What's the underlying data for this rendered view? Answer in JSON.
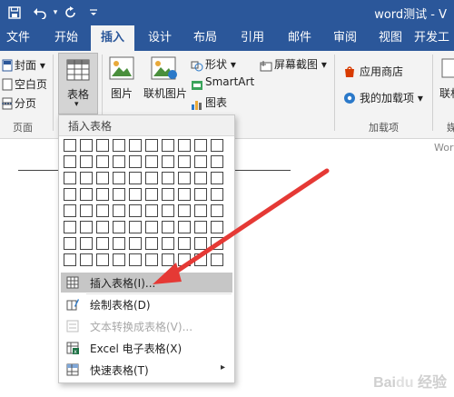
{
  "titlebar": {
    "save_icon": "save-icon",
    "undo_icon": "undo-icon",
    "undo_dropdown_icon": "chevron-down-icon",
    "redo_icon": "redo-icon",
    "customize_icon": "chevron-down-icon",
    "title": "word测试 - V"
  },
  "tabs": [
    "文件",
    "开始",
    "插入",
    "设计",
    "布局",
    "引用",
    "邮件",
    "审阅",
    "视图",
    "开发工"
  ],
  "active_tab": "插入",
  "ribbon": {
    "pages_group": {
      "cover_page": "封面",
      "blank_page": "空白页",
      "page_break": "分页",
      "label": "页面"
    },
    "table_button": {
      "label": "表格",
      "arrow": "▾"
    },
    "picture_button": "图片",
    "online_picture_button": "联机图片",
    "shapes_button": "形状",
    "smartart_button": "SmartArt",
    "chart_button": "图表",
    "screenshot_button": "屏幕截图",
    "app_store_button": "应用商店",
    "my_addins_button": "我的加载项",
    "addins_label": "加载项",
    "online_video_partial": "联机",
    "media_label_partial": "媒"
  },
  "document": {
    "word_hint": "Wor"
  },
  "dropdown": {
    "header": "插入表格",
    "grid": {
      "cols": 10,
      "rows": 8
    },
    "items": [
      {
        "label": "插入表格(I)...",
        "icon": "table-insert-icon",
        "highlighted": true,
        "disabled": false
      },
      {
        "label": "绘制表格(D)",
        "icon": "draw-table-icon",
        "highlighted": false,
        "disabled": false
      },
      {
        "label": "文本转换成表格(V)...",
        "icon": "text-to-table-icon",
        "highlighted": false,
        "disabled": true
      },
      {
        "label": "Excel 电子表格(X)",
        "icon": "excel-spreadsheet-icon",
        "highlighted": false,
        "disabled": false
      },
      {
        "label": "快速表格(T)",
        "icon": "quick-tables-icon",
        "highlighted": false,
        "disabled": false,
        "submenu": "▸"
      }
    ]
  },
  "annotation": {
    "arrow_color": "#e53935"
  },
  "colors": {
    "accent": "#2b579a",
    "ribbon_bg": "#f3f3f3",
    "highlight": "#c6c6c6"
  },
  "watermark": "Baidu 经验"
}
